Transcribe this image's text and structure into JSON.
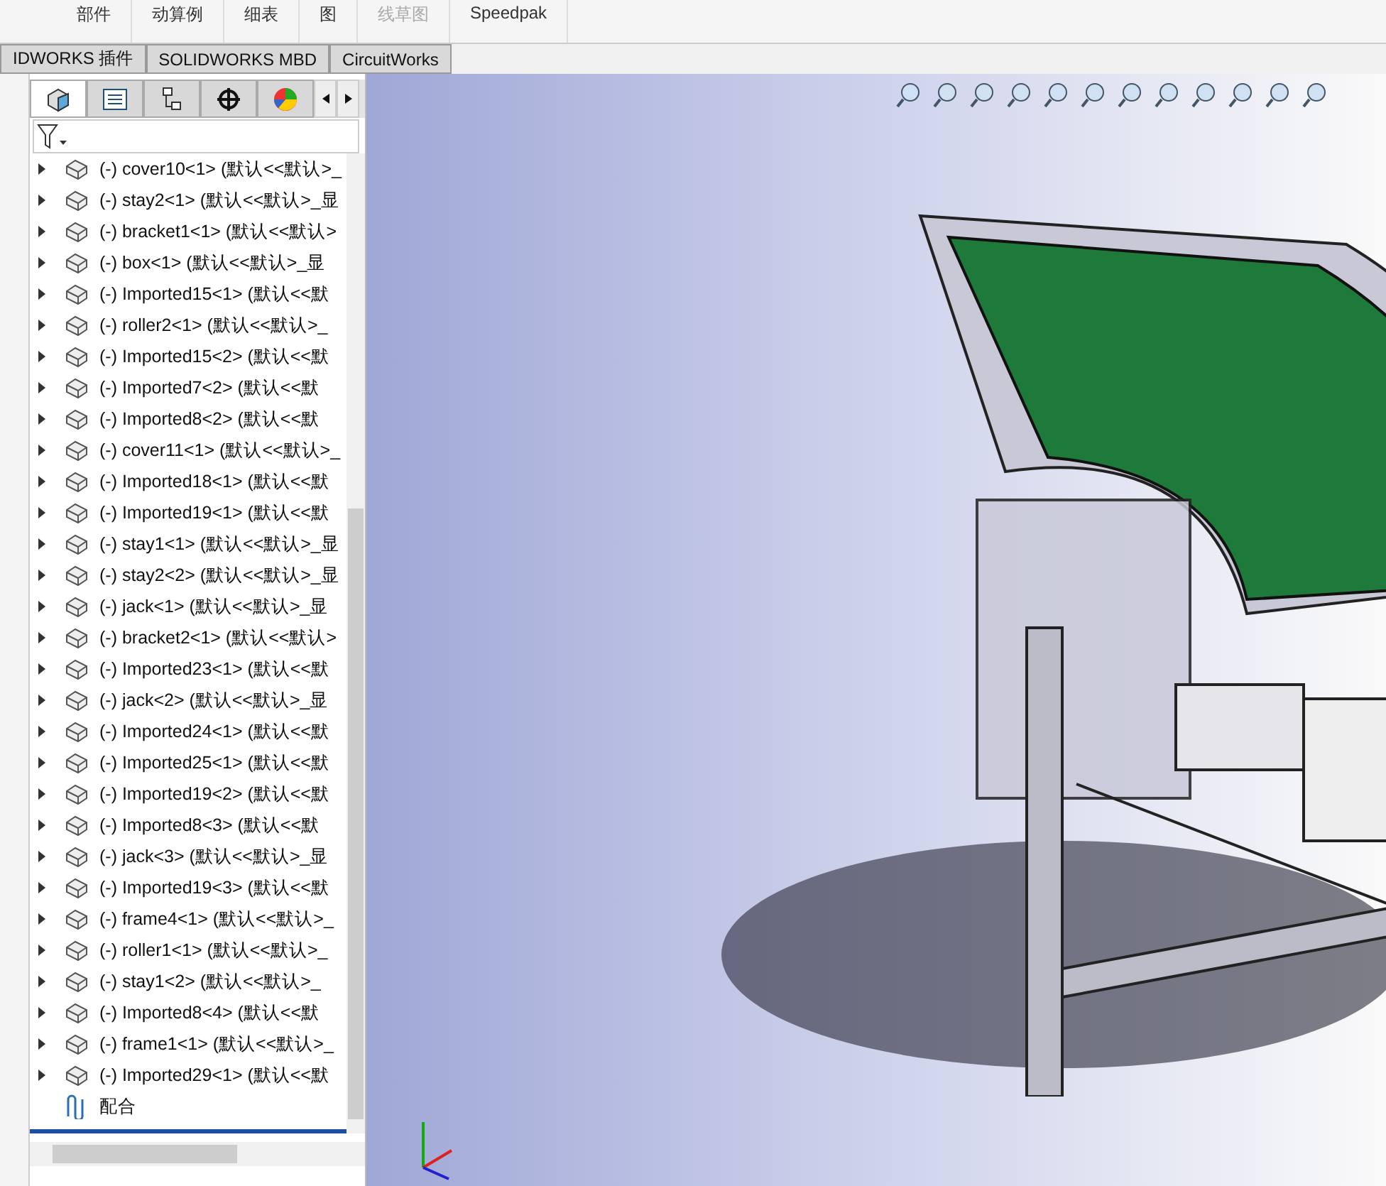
{
  "ribbon": {
    "groups": [
      {
        "label": "部件",
        "disabled": false
      },
      {
        "label": "动算例",
        "disabled": false
      },
      {
        "label": "细表",
        "disabled": false
      },
      {
        "label": "图",
        "disabled": false
      },
      {
        "label": "线草图",
        "disabled": true
      },
      {
        "label": "Speedpak",
        "disabled": false
      }
    ]
  },
  "tabs": [
    {
      "label": "IDWORKS 插件"
    },
    {
      "label": "SOLIDWORKS MBD"
    },
    {
      "label": "CircuitWorks"
    }
  ],
  "tree": {
    "items": [
      {
        "label": "(-) cover10<1> (默认<<默认>_"
      },
      {
        "label": "(-) stay2<1> (默认<<默认>_显"
      },
      {
        "label": "(-) bracket1<1> (默认<<默认>"
      },
      {
        "label": "(-) box<1> (默认<<默认>_显"
      },
      {
        "label": "(-) Imported15<1> (默认<<默"
      },
      {
        "label": "(-) roller2<1> (默认<<默认>_"
      },
      {
        "label": "(-) Imported15<2> (默认<<默"
      },
      {
        "label": "(-) Imported7<2> (默认<<默"
      },
      {
        "label": "(-) Imported8<2> (默认<<默"
      },
      {
        "label": "(-) cover11<1> (默认<<默认>_"
      },
      {
        "label": "(-) Imported18<1> (默认<<默"
      },
      {
        "label": "(-) Imported19<1> (默认<<默"
      },
      {
        "label": "(-) stay1<1> (默认<<默认>_显"
      },
      {
        "label": "(-) stay2<2> (默认<<默认>_显"
      },
      {
        "label": "(-) jack<1> (默认<<默认>_显"
      },
      {
        "label": "(-) bracket2<1> (默认<<默认>"
      },
      {
        "label": "(-) Imported23<1> (默认<<默"
      },
      {
        "label": "(-) jack<2> (默认<<默认>_显"
      },
      {
        "label": "(-) Imported24<1> (默认<<默"
      },
      {
        "label": "(-) Imported25<1> (默认<<默"
      },
      {
        "label": "(-) Imported19<2> (默认<<默"
      },
      {
        "label": "(-) Imported8<3> (默认<<默"
      },
      {
        "label": "(-) jack<3> (默认<<默认>_显"
      },
      {
        "label": "(-) Imported19<3> (默认<<默"
      },
      {
        "label": "(-) frame4<1> (默认<<默认>_"
      },
      {
        "label": "(-) roller1<1> (默认<<默认>_"
      },
      {
        "label": "(-) stay1<2> (默认<<默认>_"
      },
      {
        "label": "(-) Imported8<4> (默认<<默"
      },
      {
        "label": "(-) frame1<1> (默认<<默认>_"
      },
      {
        "label": "(-) Imported29<1> (默认<<默"
      }
    ],
    "mates": {
      "label": "配合"
    }
  }
}
